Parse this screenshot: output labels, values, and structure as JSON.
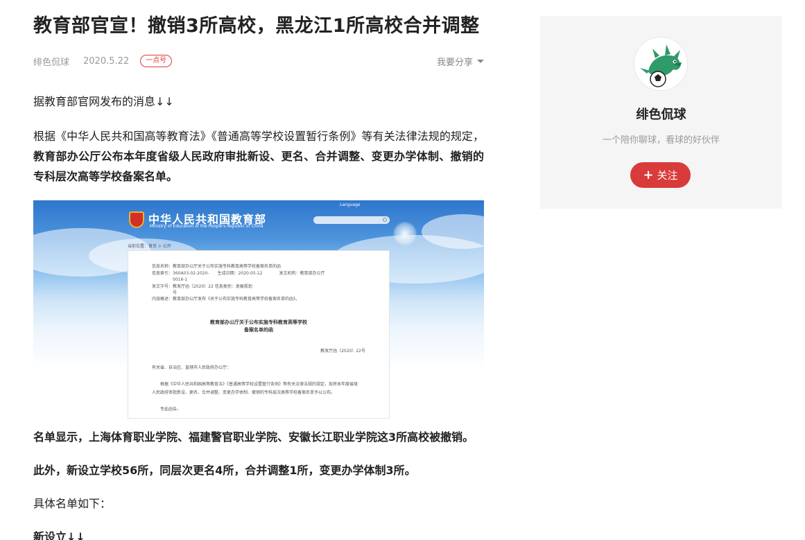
{
  "article": {
    "title": "教育部官宣！撤销3所高校，黑龙江1所高校合并调整",
    "author": "绯色侃球",
    "date": "2020.5.22",
    "badge": "一点号",
    "share_label": "我要分享",
    "intro": "据教育部官网发布的消息↓↓",
    "law_text_plain": "根据《中华人民共和国高等教育法》《普通高等学校设置暂行条例》等有关法律法规的规定，",
    "law_text_bold": "教育部办公厅公布本年度省级人民政府审批新设、更名、合并调整、变更办学体制、撤销的专科层次高等学校备案名单。",
    "list_text": "名单显示，上海体育职业学院、福建警官职业学院、安徽长江职业学院这3所高校被撤销。",
    "extra_text": "此外，新设立学校56所，同层次更名4所，合并调整1所，变更办学体制3所。",
    "detail_text": "具体名单如下：",
    "new_section": "新设立↓↓"
  },
  "figure": {
    "site_name_cn": "中华人民共和国教育部",
    "site_name_en": "Ministry of Education of the People's Republic of China",
    "language_label": "Language",
    "breadcrumb": "当前位置：首页 > 公开",
    "meta_rows": [
      "信息名称：教育部办公厅关于公布实施专科教育高等学校备案名单的函",
      "信息索引：360A03-02-2020-　　生成日期：2020-05-12　　　　发文机构：教育部办公厅",
      "　　　　　0016-1",
      "发文字号：教发厅函〔2020〕22  信息类别：发展规划",
      "　　　　　号",
      "内容概述：教育部办公厅发布《关于公布实施专科教育高等学校备案名单的函》。"
    ],
    "doc_title_line1": "教育部办公厅关于公布实施专科教育高等学校",
    "doc_title_line2": "备案名单的函",
    "doc_number": "教发厅函〔2020〕22号",
    "doc_salutation": "有关省、自治区、直辖市人民政府办公厅：",
    "doc_body_1": "根据《中华人民共和国高等教育法》《普通高等学校设置暂行条例》等有关法律法规的规定，现将本年度省级",
    "doc_body_2": "人民政府审批新设、更名、合并调整、变更办学体制、撤销的专科层次高等学校备案名单予以公布。",
    "doc_closing": "专此函告。"
  },
  "sidebar": {
    "name": "绯色侃球",
    "description": "一个陪你聊球，看球的好伙伴",
    "follow_label": "关注",
    "follow_icon": "plus-icon",
    "avatar_icon": "dragon-football-avatar",
    "accent_color": "#d93a3a"
  }
}
